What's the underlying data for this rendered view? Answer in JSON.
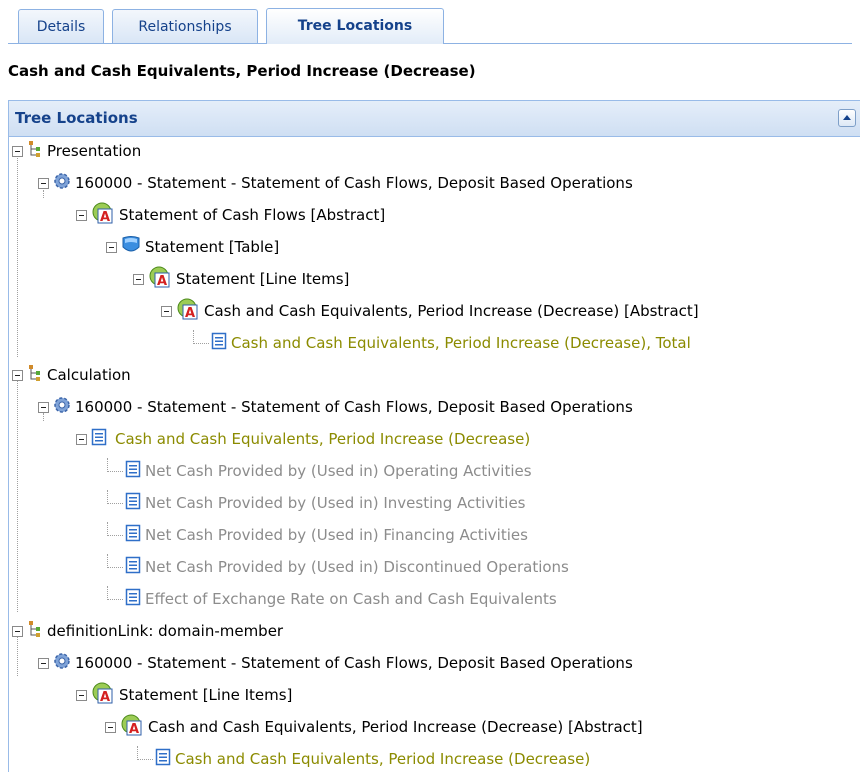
{
  "tabs": [
    {
      "label": "Details"
    },
    {
      "label": "Relationships"
    },
    {
      "label": "Tree Locations",
      "active": true
    }
  ],
  "concept_title": "Cash and Cash Equivalents, Period Increase (Decrease)",
  "panel": {
    "title": "Tree Locations"
  },
  "tree": [
    {
      "text": "Presentation",
      "icon": "tree-icon"
    },
    {
      "text": "160000 - Statement - Statement of Cash Flows, Deposit Based Operations",
      "icon": "gear-icon"
    },
    {
      "text": "Statement of Cash Flows [Abstract]",
      "icon": "abstract-icon"
    },
    {
      "text": "Statement [Table]",
      "icon": "table-icon"
    },
    {
      "text": "Statement [Line Items]",
      "icon": "abstract-icon"
    },
    {
      "text": "Cash and Cash Equivalents, Period Increase (Decrease) [Abstract]",
      "icon": "abstract-icon"
    },
    {
      "text": "Cash and Cash Equivalents, Period Increase (Decrease), Total",
      "icon": "document-icon"
    },
    {
      "text": "Calculation",
      "icon": "tree-icon"
    },
    {
      "text": "160000 - Statement - Statement of Cash Flows, Deposit Based Operations",
      "icon": "gear-icon"
    },
    {
      "text": "Cash and Cash Equivalents, Period Increase (Decrease)",
      "icon": "document-icon"
    },
    {
      "text": "Net Cash Provided by (Used in) Operating Activities",
      "icon": "document-icon"
    },
    {
      "text": "Net Cash Provided by (Used in) Investing Activities",
      "icon": "document-icon"
    },
    {
      "text": "Net Cash Provided by (Used in) Financing Activities",
      "icon": "document-icon"
    },
    {
      "text": "Net Cash Provided by (Used in) Discontinued Operations",
      "icon": "document-icon"
    },
    {
      "text": "Effect of Exchange Rate on Cash and Cash Equivalents",
      "icon": "document-icon"
    },
    {
      "text": "definitionLink: domain-member",
      "icon": "tree-icon"
    },
    {
      "text": "160000 - Statement - Statement of Cash Flows, Deposit Based Operations",
      "icon": "gear-icon"
    },
    {
      "text": "Statement [Line Items]",
      "icon": "abstract-icon"
    },
    {
      "text": "Cash and Cash Equivalents, Period Increase (Decrease) [Abstract]",
      "icon": "abstract-icon"
    },
    {
      "text": "Cash and Cash Equivalents, Period Increase (Decrease)",
      "icon": "document-icon"
    }
  ],
  "colors": {
    "header_text": "#15428b",
    "highlight_text": "#8b8b00",
    "muted_text": "#8c8c8c",
    "border": "#99bbe8"
  }
}
